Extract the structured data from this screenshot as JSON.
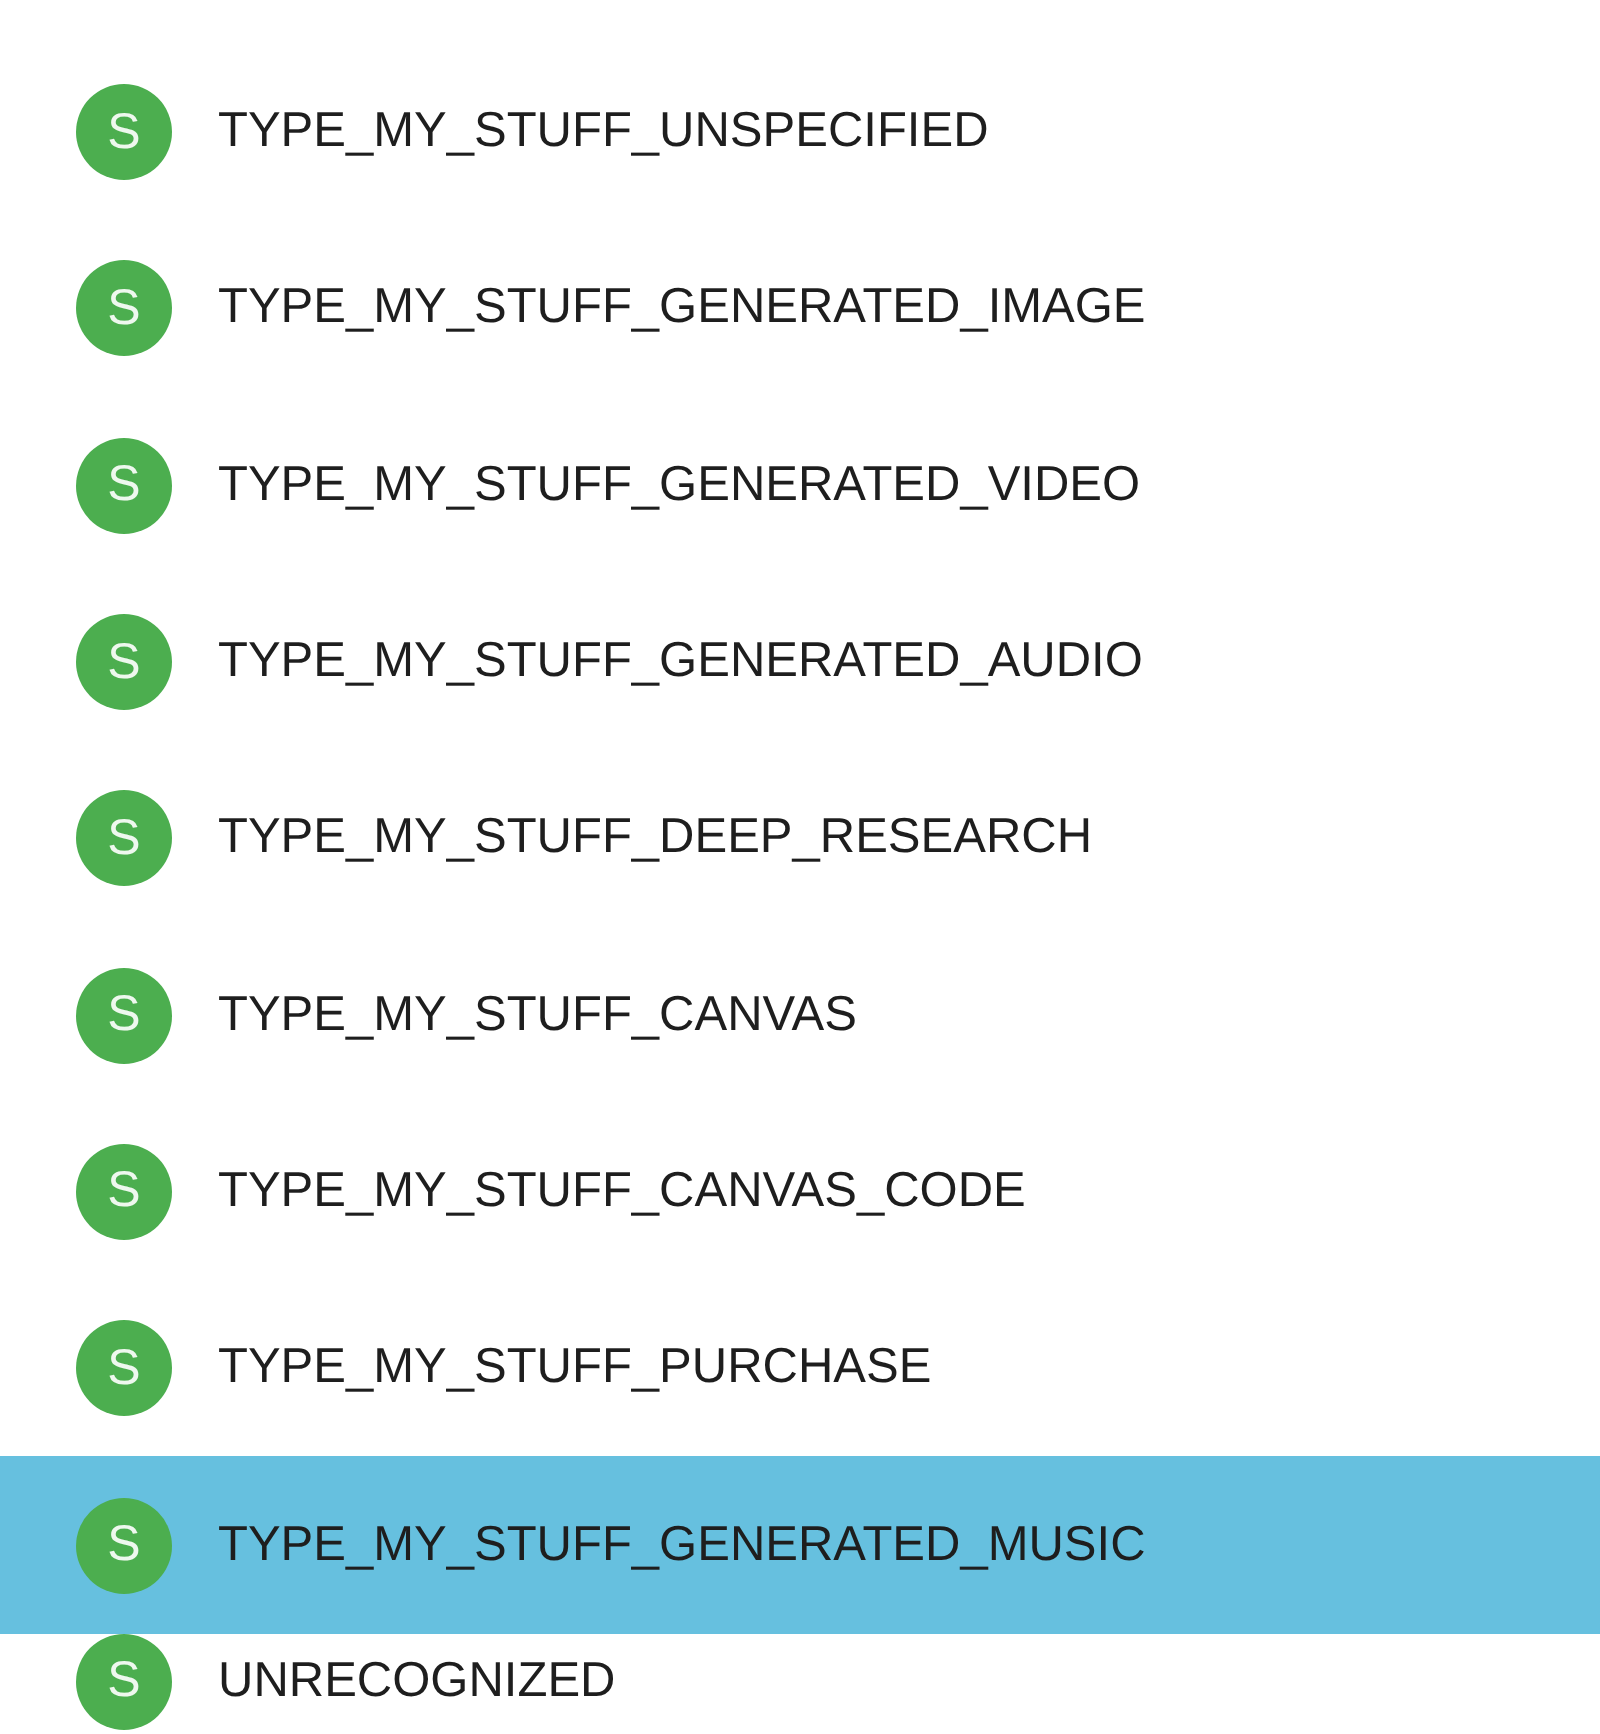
{
  "items": [
    {
      "avatar": "S",
      "label": "TYPE_MY_STUFF_UNSPECIFIED",
      "selected": false
    },
    {
      "avatar": "S",
      "label": "TYPE_MY_STUFF_GENERATED_IMAGE",
      "selected": false
    },
    {
      "avatar": "S",
      "label": "TYPE_MY_STUFF_GENERATED_VIDEO",
      "selected": false
    },
    {
      "avatar": "S",
      "label": "TYPE_MY_STUFF_GENERATED_AUDIO",
      "selected": false
    },
    {
      "avatar": "S",
      "label": "TYPE_MY_STUFF_DEEP_RESEARCH",
      "selected": false
    },
    {
      "avatar": "S",
      "label": "TYPE_MY_STUFF_CANVAS",
      "selected": false
    },
    {
      "avatar": "S",
      "label": "TYPE_MY_STUFF_CANVAS_CODE",
      "selected": false
    },
    {
      "avatar": "S",
      "label": "TYPE_MY_STUFF_PURCHASE",
      "selected": false
    },
    {
      "avatar": "S",
      "label": "TYPE_MY_STUFF_GENERATED_MUSIC",
      "selected": true
    },
    {
      "avatar": "S",
      "label": "UNRECOGNIZED",
      "selected": false
    }
  ]
}
